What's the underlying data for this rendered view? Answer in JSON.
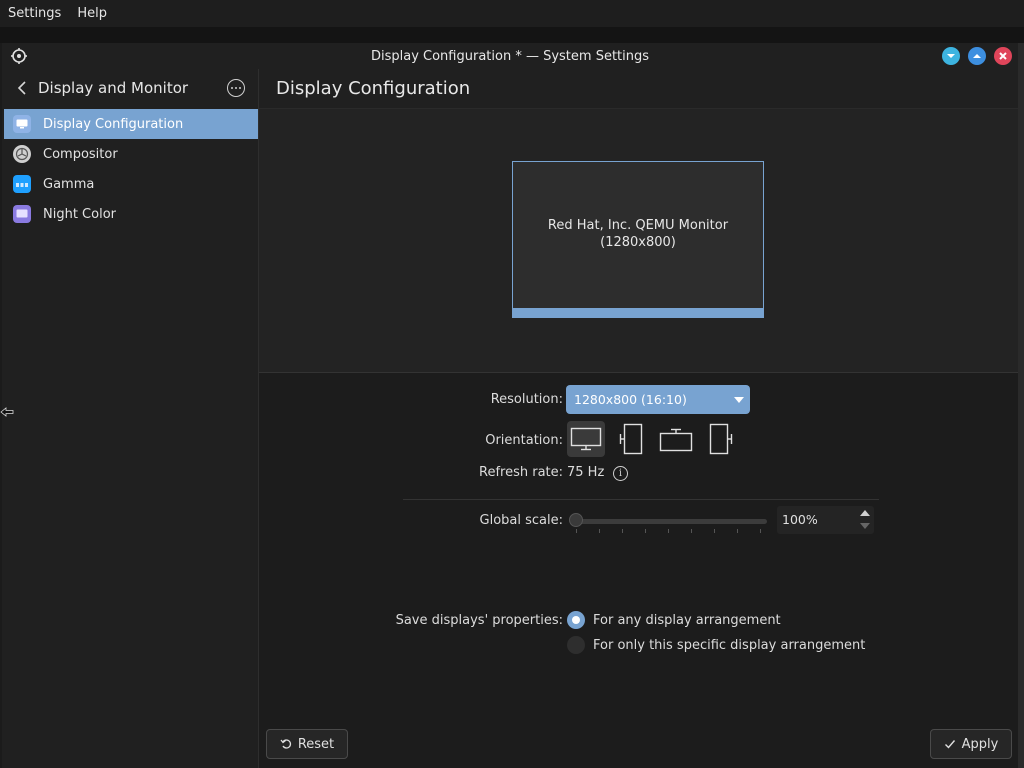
{
  "menubar": {
    "items": [
      "Settings",
      "Help"
    ]
  },
  "window": {
    "title": "Display Configuration * — System Settings"
  },
  "sidebar": {
    "header": "Display and Monitor",
    "items": [
      {
        "label": "Display Configuration",
        "icon": "display-icon",
        "active": true
      },
      {
        "label": "Compositor",
        "icon": "compositor-icon",
        "active": false
      },
      {
        "label": "Gamma",
        "icon": "gamma-icon",
        "active": false
      },
      {
        "label": "Night Color",
        "icon": "night-color-icon",
        "active": false
      }
    ]
  },
  "main": {
    "title": "Display Configuration",
    "monitor": {
      "name": "Red Hat, Inc. QEMU Monitor",
      "resolution": "(1280x800)"
    },
    "resolution": {
      "label": "Resolution:",
      "value": "1280x800 (16:10)"
    },
    "orientation": {
      "label": "Orientation:",
      "options": [
        "landscape",
        "portrait",
        "landscape-flipped",
        "portrait-flipped"
      ],
      "selected": "landscape"
    },
    "refresh": {
      "label": "Refresh rate:",
      "value": "75 Hz"
    },
    "scale": {
      "label": "Global scale:",
      "value": "100%",
      "level": 0
    },
    "save": {
      "label": "Save displays' properties:",
      "options": [
        "For any display arrangement",
        "For only this specific display arrangement"
      ],
      "selected": 0
    },
    "buttons": {
      "reset": "Reset",
      "apply": "Apply"
    }
  },
  "colors": {
    "accent": "#78a3d1",
    "background": "#1c1c1c",
    "minimize": "#3db4e0",
    "maximize": "#3d8fe0",
    "close": "#e0455a"
  }
}
